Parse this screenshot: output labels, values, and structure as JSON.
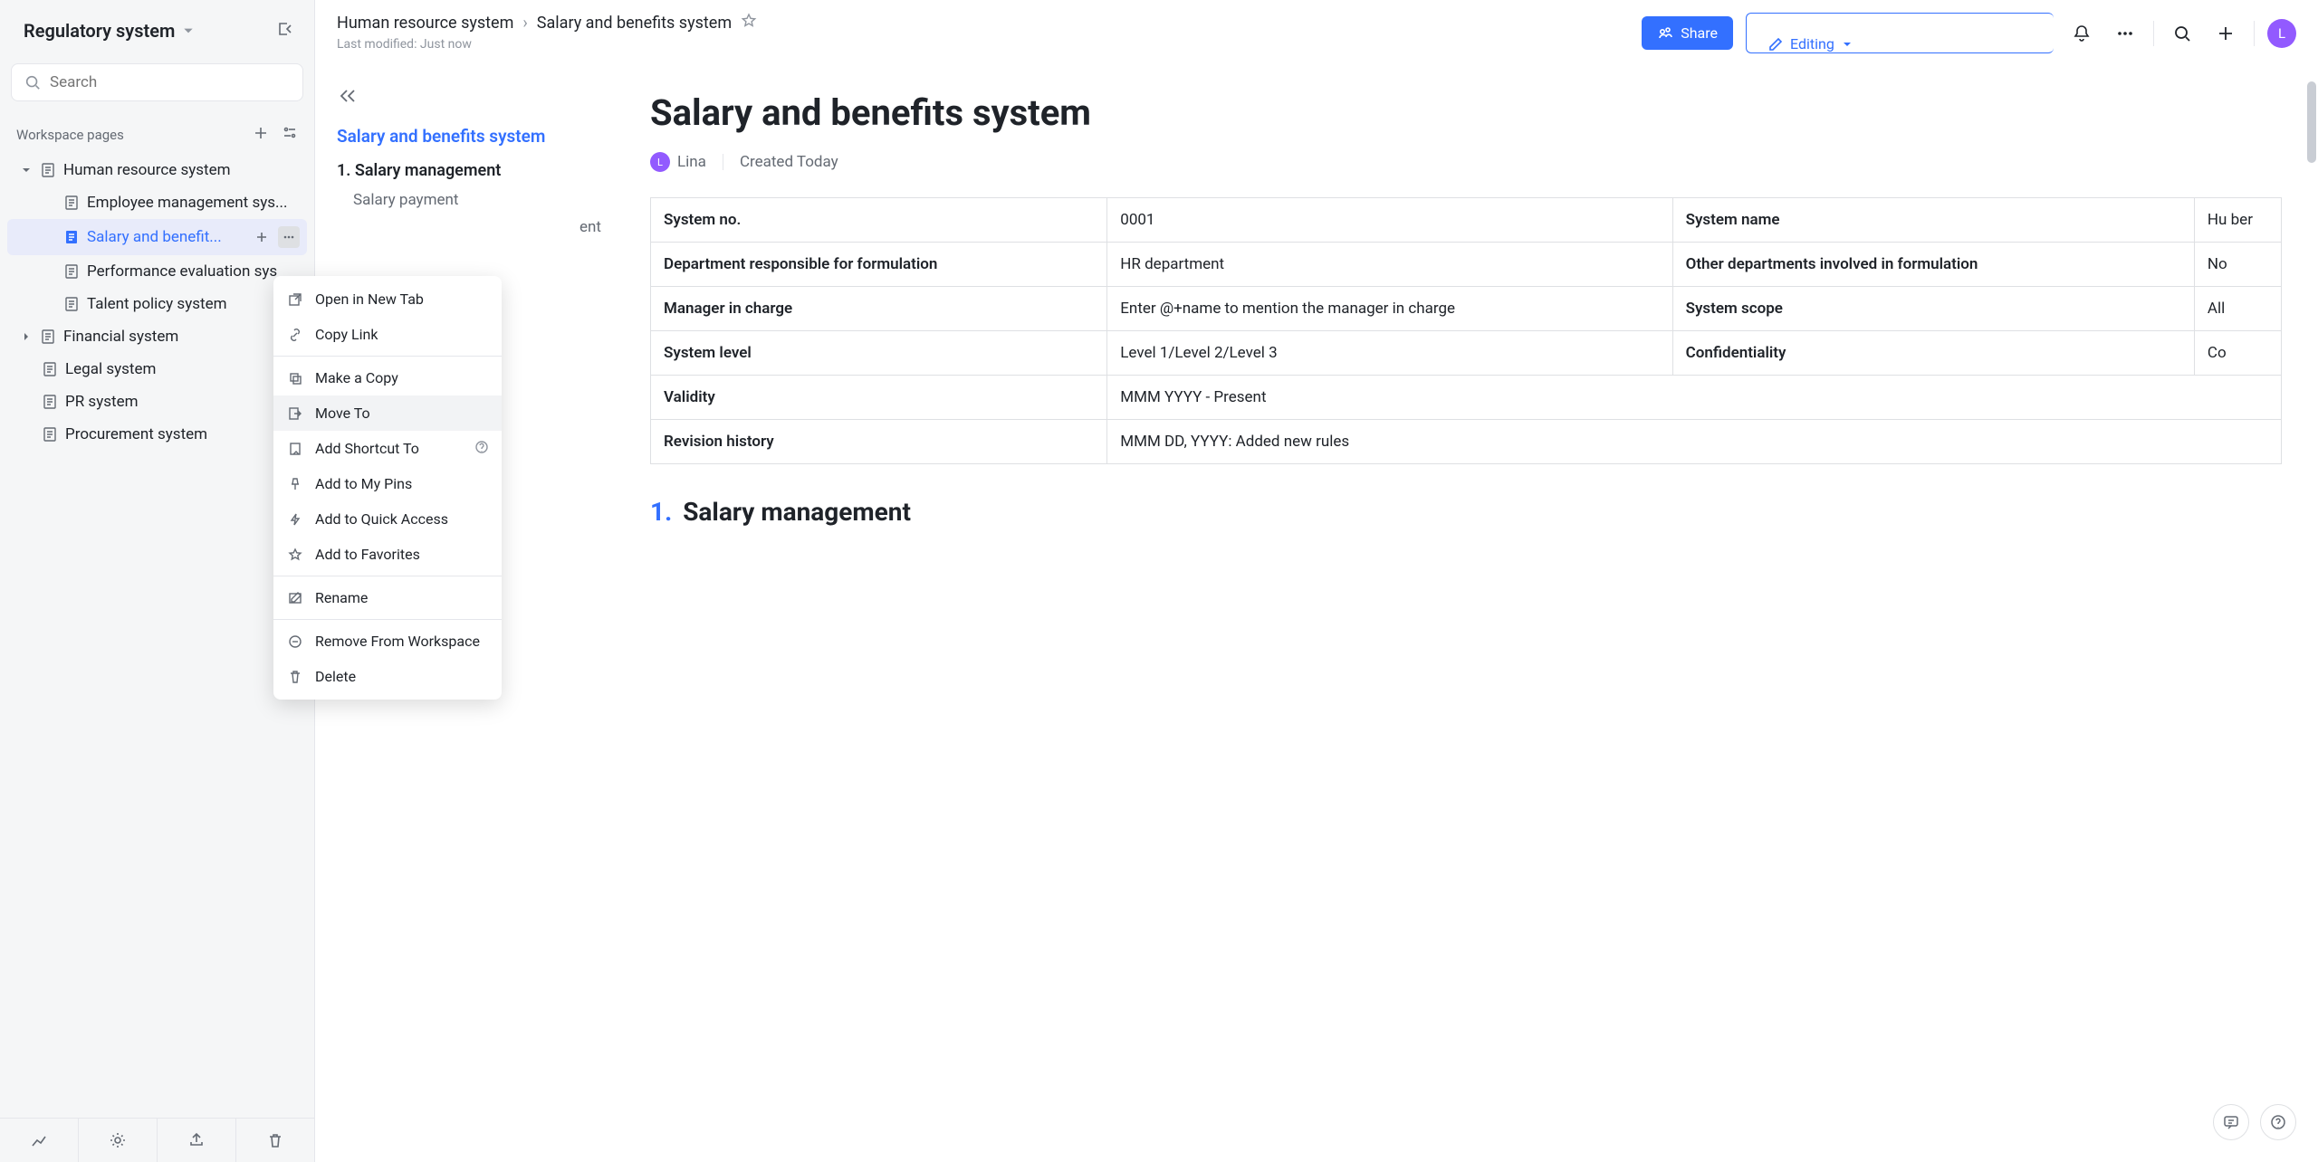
{
  "workspace": {
    "title": "Regulatory system",
    "search_placeholder": "Search",
    "section_label": "Workspace pages"
  },
  "tree": [
    {
      "label": "Human resource system",
      "depth": 0,
      "expanded": true,
      "active": false
    },
    {
      "label": "Employee management sys...",
      "depth": 1,
      "active": false
    },
    {
      "label": "Salary and benefit...",
      "depth": 1,
      "active": true
    },
    {
      "label": "Performance evaluation sys",
      "depth": 1,
      "active": false
    },
    {
      "label": "Talent policy system",
      "depth": 1,
      "active": false
    },
    {
      "label": "Financial system",
      "depth": 0,
      "expanded": false,
      "active": false
    },
    {
      "label": "Legal system",
      "depth": 0,
      "leaf": true
    },
    {
      "label": "PR system",
      "depth": 0,
      "leaf": true
    },
    {
      "label": "Procurement system",
      "depth": 0,
      "leaf": true
    }
  ],
  "context_menu": {
    "open_new_tab": "Open in New Tab",
    "copy_link": "Copy Link",
    "make_copy": "Make a Copy",
    "move_to": "Move To",
    "add_shortcut": "Add Shortcut To",
    "add_pins": "Add to My Pins",
    "add_quick": "Add to Quick Access",
    "add_fav": "Add to Favorites",
    "rename": "Rename",
    "remove_ws": "Remove From Workspace",
    "delete": "Delete"
  },
  "breadcrumb": {
    "parent": "Human resource system",
    "current": "Salary and benefits system",
    "last_modified": "Last modified: Just now"
  },
  "topbar": {
    "share": "Share",
    "editing": "Editing",
    "avatar_letter": "L"
  },
  "outline": {
    "title": "Salary and benefits system",
    "h1": "1. Salary management",
    "sub1": "Salary payment",
    "sub2_tail": "ent"
  },
  "document": {
    "title": "Salary and benefits system",
    "author": "Lina",
    "author_initial": "L",
    "created": "Created Today",
    "table": {
      "r1c1": "System no.",
      "r1c2": "0001",
      "r1c3": "System name",
      "r1c4": "Hu ber",
      "r2c1": "Department responsible for formulation",
      "r2c2": "HR department",
      "r2c3": "Other departments involved in formulation",
      "r2c4": "No",
      "r3c1": "Manager in charge",
      "r3c2": "Enter @+name to mention the manager in charge",
      "r3c3": "System scope",
      "r3c4": "All",
      "r4c1": "System level",
      "r4c2": "Level 1/Level 2/Level 3",
      "r4c3": "Confidentiality",
      "r4c4": "Co",
      "r5c1": "Validity",
      "r5c2": "MMM YYYY - Present",
      "r6c1": "Revision history",
      "r6c2": "MMM DD, YYYY: Added new rules"
    },
    "section1_num": "1.",
    "section1_title": "Salary management"
  }
}
